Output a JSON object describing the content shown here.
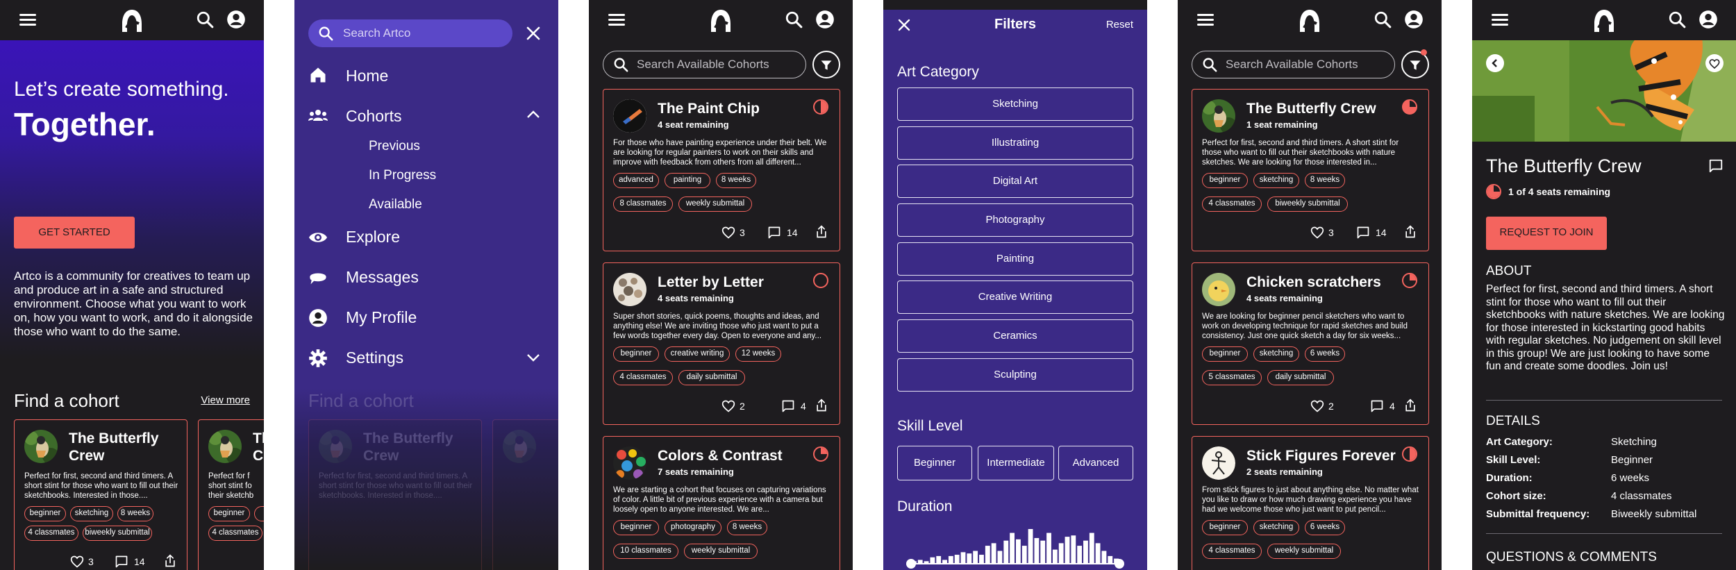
{
  "header": {
    "menu_icon": "hamburger-icon",
    "logo_icon": "artco-logo",
    "search_icon": "search-icon",
    "account_icon": "account-icon"
  },
  "home": {
    "headline_1": "Let’s create something.",
    "headline_2": "Together.",
    "cta": "GET STARTED",
    "intro": "Artco is a community for creatives to team up and produce art in a safe and structured environment. Choose what you want to work on, how you want to work, and do it alongside those who want to do the same.",
    "find_title": "Find a cohort",
    "view_more": "View more",
    "card": {
      "title": "The Butterfly Crew",
      "desc": "Perfect for first, second and third timers. A short stint for those who want to fill out their sketchbooks. Interested in those....",
      "tags": [
        "beginner",
        "sketching",
        "8 weeks",
        "4 classmates",
        "biweekly submittal"
      ],
      "likes": "3",
      "comments": "14"
    },
    "card_peek": {
      "title": "Th C",
      "desc": "Perfect for f short stint fo their sketchb",
      "tags": [
        "beginner",
        "sk",
        "4 classmates"
      ]
    }
  },
  "nav": {
    "search_placeholder": "Search Artco",
    "items": [
      {
        "label": "Home",
        "icon": "home-icon"
      },
      {
        "label": "Cohorts",
        "icon": "people-icon"
      },
      {
        "label": "Explore",
        "icon": "eye-icon"
      },
      {
        "label": "Messages",
        "icon": "chat-icon"
      },
      {
        "label": "My Profile",
        "icon": "profile-icon"
      },
      {
        "label": "Settings",
        "icon": "gear-icon"
      }
    ],
    "sub_items": [
      "Previous",
      "In Progress",
      "Available"
    ]
  },
  "cohorts": {
    "search_placeholder": "Search Available Cohorts",
    "cards": [
      {
        "title": "The Paint Chip",
        "seats": "4 seat remaining",
        "desc": "For those who have painting experience under their belt. We are looking for regular painters to work on their skills and improve with feedback from others from all different...",
        "tags": [
          "advanced",
          "painting",
          "8 weeks",
          "8 classmates",
          "weekly submittal"
        ],
        "likes": "3",
        "comments": "14",
        "fill": 0.5
      },
      {
        "title": "Letter by Letter",
        "seats": "4 seats remaining",
        "desc": "Super short stories, quick poems, thoughts and ideas, and anything else! We are inviting those who just want to put a few words together every day. Open to everyone and any...",
        "tags": [
          "beginner",
          "creative writing",
          "12 weeks",
          "4 classmates",
          "daily submittal"
        ],
        "likes": "2",
        "comments": "4",
        "fill": 0
      },
      {
        "title": "Colors & Contrast",
        "seats": "7 seats remaining",
        "desc": "We are starting a cohort that focuses on capturing variations of color. A little bit of previous experience with a camera but loosely open to anyone interested. We are...",
        "tags": [
          "beginner",
          "photography",
          "8 weeks",
          "10 classmates",
          "weekly submittal"
        ],
        "fill": 0.3
      }
    ]
  },
  "filters": {
    "title": "Filters",
    "reset": "Reset",
    "category_label": "Art Category",
    "categories": [
      "Sketching",
      "Illustrating",
      "Digital Art",
      "Photography",
      "Painting",
      "Creative Writing",
      "Ceramics",
      "Sculpting"
    ],
    "skill_label": "Skill Level",
    "skills": [
      "Beginner",
      "Intermediate",
      "Advanced"
    ],
    "duration_label": "Duration",
    "histogram": [
      2,
      3,
      2,
      5,
      6,
      3,
      6,
      7,
      9,
      8,
      10,
      7,
      14,
      16,
      10,
      18,
      24,
      19,
      14,
      27,
      20,
      18,
      24,
      11,
      16,
      21,
      22,
      14,
      18,
      24,
      16,
      10,
      6,
      4
    ]
  },
  "filtered": {
    "search_placeholder": "Search Available Cohorts",
    "cards": [
      {
        "title": "The Butterfly Crew",
        "seats": "1 seat remaining",
        "desc": "Perfect for first, second and third timers. A short stint for those who want to fill out their sketchbooks with nature sketches. We are looking for those interested in...",
        "tags": [
          "beginner",
          "sketching",
          "8 weeks",
          "4 classmates",
          "biweekly submittal"
        ],
        "likes": "3",
        "comments": "14",
        "fill": 0.75
      },
      {
        "title": "Chicken scratchers",
        "seats": "4 seats remaining",
        "desc": "We are looking for beginner pencil sketchers who want to work on developing technique for rapid sketches and build consistency. Just one quick sketch a day for six weeks...",
        "tags": [
          "beginner",
          "sketching",
          "6 weeks",
          "5 classmates",
          "daily submittal"
        ],
        "likes": "2",
        "comments": "4",
        "fill": 0.25
      },
      {
        "title": "Stick Figures Forever",
        "seats": "2 seats remaining",
        "desc": "From stick figures to just about anything else. No matter what you like to draw or how much drawing experience you have had we welcome those who just want to put pencil...",
        "tags": [
          "beginner",
          "sketching",
          "6 weeks",
          "4 classmates",
          "weekly submittal"
        ],
        "fill": 0.5
      }
    ]
  },
  "detail": {
    "title": "The Butterfly Crew",
    "seats": "1 of 4 seats remaining",
    "cta": "REQUEST TO JOIN",
    "about_label": "ABOUT",
    "about": "Perfect for first, second and third timers. A short stint for those who want to fill out their sketchbooks with nature sketches. We are looking for those interested in kickstarting good habits with regular sketches. No judgement on skill level in this group! We are just looking to have some fun and create some doodles. Join us!",
    "details_label": "DETAILS",
    "details": [
      {
        "k": "Art Category:",
        "v": "Sketching"
      },
      {
        "k": "Skill Level:",
        "v": "Beginner"
      },
      {
        "k": "Duration:",
        "v": "6 weeks"
      },
      {
        "k": "Cohort size:",
        "v": "4 classmates"
      },
      {
        "k": "Submittal frequency:",
        "v": "Biweekly submittal"
      }
    ],
    "qc_label": "QUESTIONS & COMMENTS"
  },
  "colors": {
    "accent": "#f4645e",
    "purple": "#3b2a86",
    "dark": "#1e1c1f",
    "nav_search": "#5b48c8"
  }
}
